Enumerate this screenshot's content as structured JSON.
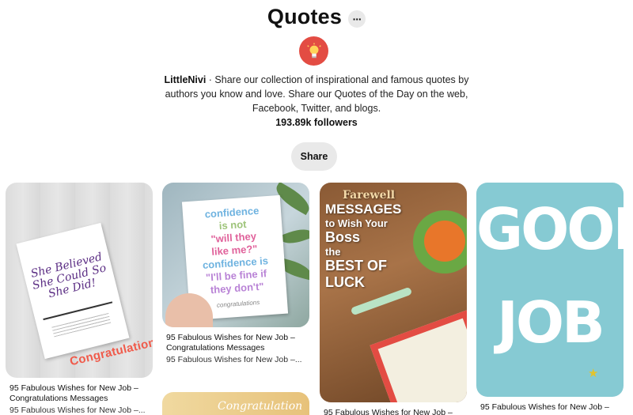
{
  "board": {
    "title": "Quotes",
    "more_label": "···",
    "owner": "LittleNivi",
    "description": " · Share our collection of inspirational and famous quotes by authors you know and love. Share our Quotes of the Day on the web, Facebook, Twitter, and blogs.",
    "followers": "193.89k followers",
    "share_label": "Share"
  },
  "pins": [
    {
      "title": "95 Fabulous Wishes for New Job – Congratulations Messages",
      "subtitle": "95 Fabulous Wishes for New Job –...",
      "image_text": {
        "card": "She Believed She Could So She Did!",
        "banner": "Congratulations"
      }
    },
    {
      "title": "95 Fabulous Wishes for New Job – Congratulations Messages",
      "subtitle": "95 Fabulous Wishes for New Job –...",
      "image_text": {
        "line1": "confidence",
        "line2": "is not",
        "line3": "\"will they",
        "line4": "like me?\"",
        "line5": "confidence is",
        "line6": "\"I'll be fine if",
        "line7": "they don't\"",
        "footer": "congratulations"
      }
    },
    {
      "title": "95 Fabulous Wishes for New Job –",
      "image_text": {
        "line1": "Farewell",
        "line2": "MESSAGES",
        "line3": "to Wish Your",
        "line4": "Boss",
        "line5": "the",
        "line6": "BEST OF",
        "line7": "LUCK"
      }
    },
    {
      "title": "95 Fabulous Wishes for New Job –",
      "image_text": {
        "line1": "GOOD",
        "line2": "JOB"
      }
    },
    {
      "image_text": {
        "banner": "Congratulation"
      }
    }
  ],
  "colors": {
    "avatar_bg": "#e34c43",
    "button_bg": "#e9e9e9",
    "accent_red": "#f05a4a"
  },
  "icons": {
    "avatar": "lightbulb-icon",
    "more": "ellipsis-icon",
    "star": "star-icon"
  }
}
